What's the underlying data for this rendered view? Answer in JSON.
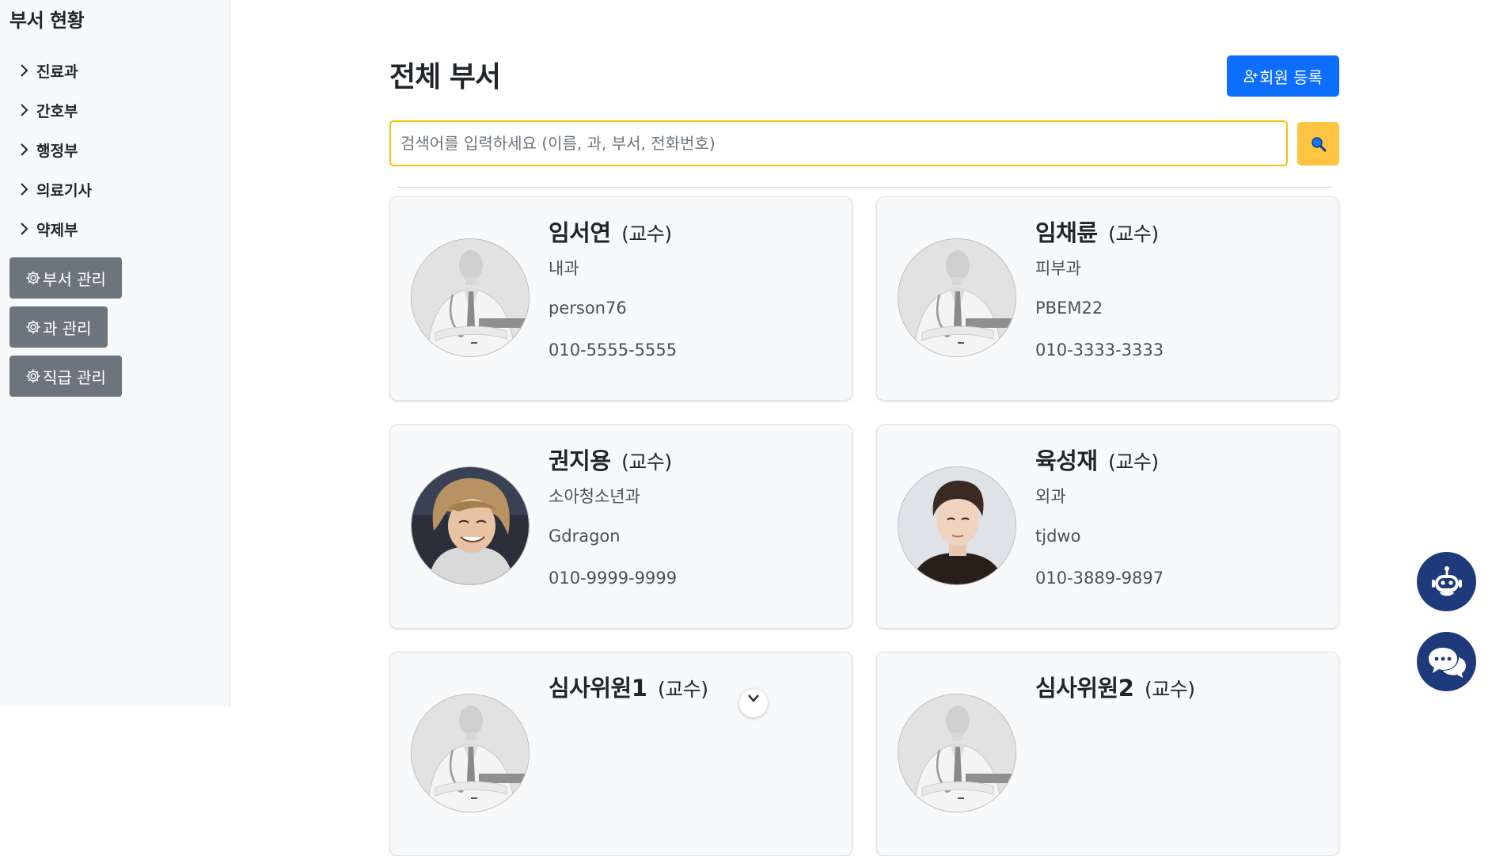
{
  "sidebar": {
    "title": "부서 현황",
    "items": [
      {
        "label": "진료과"
      },
      {
        "label": "간호부"
      },
      {
        "label": "행정부"
      },
      {
        "label": "의료기사"
      },
      {
        "label": "약제부"
      }
    ],
    "admin_buttons": [
      {
        "label": "부서 관리"
      },
      {
        "label": "과 관리"
      },
      {
        "label": "직급 관리"
      }
    ]
  },
  "main": {
    "title": "전체 부서",
    "register_label": "회원 등록",
    "search": {
      "placeholder": "검색어를 입력하세요 (이름, 과, 부서, 전화번호)",
      "value": ""
    },
    "staff": [
      {
        "name": "임서연",
        "rank": "(교수)",
        "dept": "내과",
        "id": "person76",
        "phone": "010-5555-5555",
        "avatar": "default-doctor"
      },
      {
        "name": "임채륜",
        "rank": "(교수)",
        "dept": "피부과",
        "id": "PBEM22",
        "phone": "010-3333-3333",
        "avatar": "default-doctor"
      },
      {
        "name": "권지용",
        "rank": "(교수)",
        "dept": "소아청소년과",
        "id": "Gdragon",
        "phone": "010-9999-9999",
        "avatar": "photo"
      },
      {
        "name": "육성재",
        "rank": "(교수)",
        "dept": "외과",
        "id": "tjdwo",
        "phone": "010-3889-9897",
        "avatar": "photo"
      },
      {
        "name": "심사위원1",
        "rank": "(교수)",
        "dept": "",
        "id": "",
        "phone": "",
        "avatar": "default-doctor"
      },
      {
        "name": "심사위원2",
        "rank": "(교수)",
        "dept": "",
        "id": "",
        "phone": "",
        "avatar": "default-doctor"
      }
    ]
  },
  "icons": {
    "nav": "chevron-right-icon",
    "admin": "gear-icon",
    "register": "person-plus-icon",
    "search": "magnifier-icon",
    "scroll": "chevron-down-icon",
    "fab_top": "robot-icon",
    "fab_bottom": "chat-bubbles-icon"
  },
  "colors": {
    "primary": "#0d6efd",
    "secondary": "#6c757d",
    "warning": "#ffc542",
    "search_border": "#f4c20d",
    "fab": "#1f3a7a"
  }
}
